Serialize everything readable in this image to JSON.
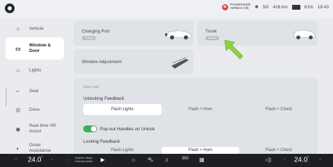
{
  "status": {
    "airbag_line1": "PASSENGER",
    "airbag_line2": "AIRBAG ON",
    "airbag_symbol": "✕",
    "range": "416 km",
    "battery": "81%",
    "time": "18:43",
    "bluetooth_icon": "bluetooth-icon",
    "signal": "5G"
  },
  "sidebar": {
    "items": [
      {
        "label": "Vehicle",
        "icon": "⌂"
      },
      {
        "label": "Window & Door",
        "icon": "▭"
      },
      {
        "label": "Lights",
        "icon": "☼"
      },
      {
        "label": "Seat",
        "icon": "⌐"
      },
      {
        "label": "Drive",
        "icon": "◎"
      },
      {
        "label": "Real-time SR Assist",
        "icon": "◉"
      },
      {
        "label": "Driver Assistance",
        "icon": "◐"
      }
    ]
  },
  "cards": {
    "charging_port": {
      "title": "Charging Port",
      "state": "Closed"
    },
    "trunk": {
      "title": "Trunk",
      "state": "Closed"
    },
    "window": {
      "title": "Window Adjustment"
    }
  },
  "door_lock": {
    "section": "Door Lock",
    "unlocking_title": "Unlocking Feedback",
    "unlocking_options": [
      "Flash Lights",
      "Flash + Horn",
      "Flash + Chord"
    ],
    "unlocking_selected": 0,
    "popout_label": "Pop-out Handles on Unlock",
    "locking_title": "Locking Feedback",
    "locking_options": [
      "Flash Lights",
      "Flash + Horn",
      "Flash + Chord"
    ],
    "locking_selected": 1
  },
  "bottom": {
    "left_temp": "24.0",
    "right_temp": "24.0",
    "deg": "°",
    "media_line1": "Anytime, Anyw..",
    "media_line2": "Unknown Artist",
    "chevron_left": "‹",
    "chevron_right": "›"
  }
}
